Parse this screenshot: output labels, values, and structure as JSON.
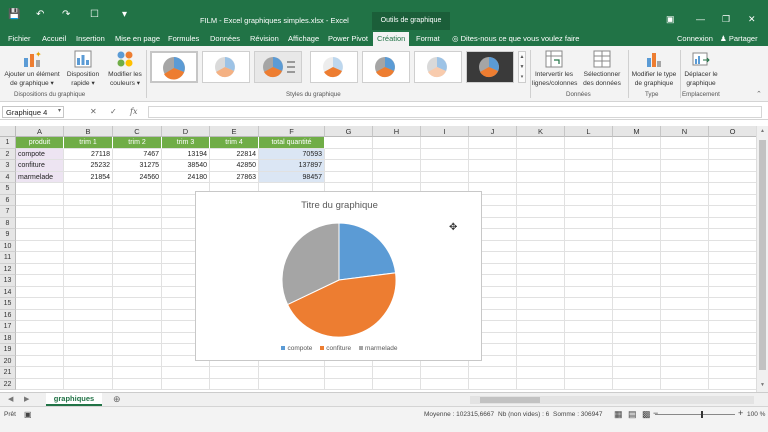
{
  "titlebar": {
    "doc_title": "FILM - Excel graphiques simples.xlsx - Excel",
    "tools_label": "Outils de graphique",
    "quick_access": [
      "save-icon",
      "undo-icon",
      "redo-icon",
      "print-preview-icon",
      "customize-icon"
    ]
  },
  "menu": {
    "tabs": [
      "Fichier",
      "Accueil",
      "Insertion",
      "Mise en page",
      "Formules",
      "Données",
      "Révision",
      "Affichage",
      "Power Pivot",
      "Création",
      "Format"
    ],
    "active": "Création",
    "tell_me": "Dites-nous ce que vous voulez faire",
    "connexion": "Connexion",
    "partager": "Partager"
  },
  "ribbon": {
    "add_element": "Ajouter un élément de graphique",
    "quick_layout": "Disposition rapide",
    "change_colors": "Modifier les couleurs",
    "group_layouts": "Dispositions du graphique",
    "group_styles": "Styles du graphique",
    "switch_rows": "Intervertir les lignes/colonnes",
    "select_data": "Sélectionner des données",
    "group_data": "Données",
    "change_type": "Modifier le type de graphique",
    "group_type": "Type",
    "move_chart": "Déplacer le graphique",
    "group_location": "Emplacement",
    "dropdown_mark": "▾"
  },
  "formula": {
    "name_box": "Graphique 4",
    "fx": "fx",
    "cancel": "✕",
    "confirm": "✓"
  },
  "columns": [
    "A",
    "B",
    "C",
    "D",
    "E",
    "F",
    "G",
    "H",
    "I",
    "J",
    "K",
    "L",
    "M",
    "N",
    "O"
  ],
  "rows": [
    "1",
    "2",
    "3",
    "4",
    "5",
    "6",
    "7",
    "8",
    "9",
    "10",
    "11",
    "12",
    "13",
    "14",
    "15",
    "16",
    "17",
    "18",
    "19",
    "20",
    "21",
    "22"
  ],
  "table": {
    "headers": [
      "produit",
      "trim 1",
      "trim 2",
      "trim 3",
      "trim 4",
      "total quantité"
    ],
    "rows": [
      [
        "compote",
        "27118",
        "7467",
        "13194",
        "22814",
        "70593"
      ],
      [
        "confiture",
        "25232",
        "31275",
        "38540",
        "42850",
        "137897"
      ],
      [
        "marmelade",
        "21854",
        "24560",
        "24180",
        "27863",
        "98457"
      ]
    ]
  },
  "chart_data": {
    "type": "pie",
    "title": "Titre du graphique",
    "categories": [
      "compote",
      "confiture",
      "marmelade"
    ],
    "values": [
      70593,
      137897,
      98457
    ],
    "colors": [
      "#5b9bd5",
      "#ed7d31",
      "#a5a5a5"
    ],
    "legend": "bottom"
  },
  "sheets": {
    "active": "graphiques",
    "add": "⊕"
  },
  "status": {
    "ready": "Prêt",
    "average": "Moyenne : 102315,6667",
    "count": "Nb (non vides) : 6",
    "sum": "Somme : 306947",
    "zoom": "100 %",
    "zoom_minus": "−",
    "zoom_plus": "+"
  }
}
